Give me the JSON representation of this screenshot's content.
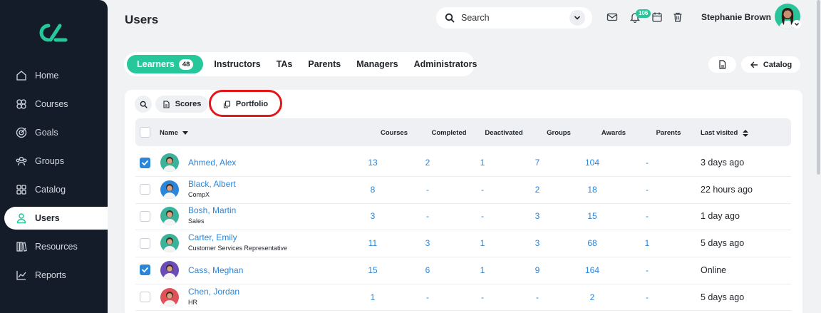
{
  "page": {
    "title": "Users"
  },
  "sidebar": {
    "items": [
      {
        "label": "Home",
        "icon": "home-icon"
      },
      {
        "label": "Courses",
        "icon": "courses-icon"
      },
      {
        "label": "Goals",
        "icon": "target-icon"
      },
      {
        "label": "Groups",
        "icon": "groups-icon"
      },
      {
        "label": "Catalog",
        "icon": "grid-icon"
      },
      {
        "label": "Users",
        "icon": "user-icon",
        "active": true
      },
      {
        "label": "Resources",
        "icon": "books-icon"
      },
      {
        "label": "Reports",
        "icon": "chart-icon"
      }
    ]
  },
  "header": {
    "search_label": "Search",
    "notification_count": "106",
    "user_name": "Stephanie Brown"
  },
  "tabs": {
    "learners_label": "Learners",
    "learners_count": "48",
    "instructors_label": "Instructors",
    "tas_label": "TAs",
    "parents_label": "Parents",
    "managers_label": "Managers",
    "administrators_label": "Administrators"
  },
  "actions": {
    "catalog_label": "Catalog"
  },
  "toolbar": {
    "scores_label": "Scores",
    "portfolio_label": "Portfolio"
  },
  "table": {
    "columns": {
      "name": "Name",
      "courses": "Courses",
      "completed": "Completed",
      "deactivated": "Deactivated",
      "groups": "Groups",
      "awards": "Awards",
      "parents": "Parents",
      "last_visited": "Last visited"
    },
    "rows": [
      {
        "name": "Ahmed, Alex",
        "sub": "",
        "checked": true,
        "courses": "13",
        "completed": "2",
        "deactivated": "1",
        "groups": "7",
        "awards": "104",
        "parents": "-",
        "last_visited": "3 days ago",
        "avatar_color": "#3bb39a"
      },
      {
        "name": "Black, Albert",
        "sub": "CompX",
        "checked": false,
        "courses": "8",
        "completed": "-",
        "deactivated": "-",
        "groups": "2",
        "awards": "18",
        "parents": "-",
        "last_visited": "22 hours ago",
        "avatar_color": "#2b86d9"
      },
      {
        "name": "Bosh, Martin",
        "sub": "Sales",
        "checked": false,
        "courses": "3",
        "completed": "-",
        "deactivated": "-",
        "groups": "3",
        "awards": "15",
        "parents": "-",
        "last_visited": "1 day ago",
        "avatar_color": "#3bb39a"
      },
      {
        "name": "Carter, Emily",
        "sub": "Customer Services Representative",
        "checked": false,
        "courses": "11",
        "completed": "3",
        "deactivated": "1",
        "groups": "3",
        "awards": "68",
        "parents": "1",
        "last_visited": "5 days ago",
        "avatar_color": "#3bb39a"
      },
      {
        "name": "Cass, Meghan",
        "sub": "",
        "checked": true,
        "courses": "15",
        "completed": "6",
        "deactivated": "1",
        "groups": "9",
        "awards": "164",
        "parents": "-",
        "last_visited": "Online",
        "avatar_color": "#6b4bb8"
      },
      {
        "name": "Chen, Jordan",
        "sub": "HR",
        "checked": false,
        "courses": "1",
        "completed": "-",
        "deactivated": "-",
        "groups": "-",
        "awards": "2",
        "parents": "-",
        "last_visited": "5 days ago",
        "avatar_color": "#e0525a"
      }
    ]
  },
  "colors": {
    "accent": "#25c79b",
    "link": "#2b86d9",
    "sidebar": "#131c28",
    "highlight": "#e3161b"
  }
}
